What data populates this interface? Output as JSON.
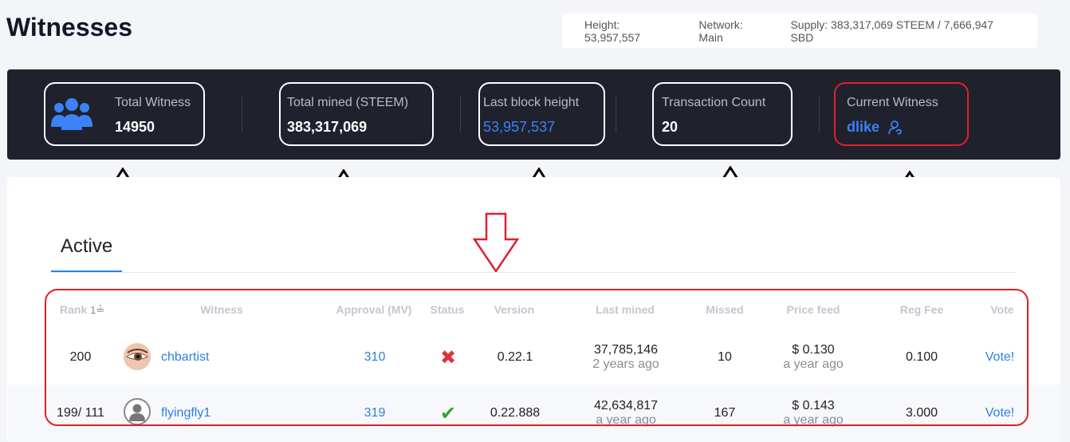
{
  "page": {
    "title": "Witnesses"
  },
  "chain_info": {
    "height": "Height: 53,957,557",
    "network": "Network: Main",
    "supply": "Supply: 383,317,069 STEEM / 7,666,947 SBD"
  },
  "stats": {
    "total_witness": {
      "label": "Total Witness",
      "value": "14950",
      "icon": "users-group-icon"
    },
    "total_mined": {
      "label": "Total mined (STEEM)",
      "value": "383,317,069"
    },
    "last_block": {
      "label": "Last block height",
      "value": "53,957,537"
    },
    "tx_count": {
      "label": "Transaction Count",
      "value": "20"
    },
    "current_witness": {
      "label": "Current Witness",
      "value": "dlike",
      "icon": "user-link-icon"
    }
  },
  "tabs": {
    "active": "Active"
  },
  "table": {
    "headers": {
      "rank": "Rank",
      "rank_sort": "1",
      "witness": "Witness",
      "approval": "Approval (MV)",
      "status": "Status",
      "version": "Version",
      "last_mined": "Last mined",
      "missed": "Missed",
      "price_feed": "Price feed",
      "reg_fee": "Reg Fee",
      "vote": "Vote"
    },
    "rows": [
      {
        "rank": "200",
        "witness": "chbartist",
        "approval": "310",
        "status": "disabled",
        "status_glyph": "✖",
        "version": "0.22.1",
        "last_mined_block": "37,785,146",
        "last_mined_ago": "2 years ago",
        "missed": "10",
        "price": "$ 0.130",
        "price_ago": "a year ago",
        "reg_fee": "0.100",
        "vote": "Vote!"
      },
      {
        "rank": "199/ 111",
        "witness": "flyingfly1",
        "approval": "319",
        "status": "active",
        "status_glyph": "✔",
        "version": "0.22.888",
        "last_mined_block": "42,634,817",
        "last_mined_ago": "a year ago",
        "missed": "167",
        "price": "$ 0.143",
        "price_ago": "a year ago",
        "reg_fee": "3.000",
        "vote": "Vote!"
      }
    ]
  },
  "colors": {
    "accent": "#2f7fe0",
    "annotation_red": "#e0202a",
    "dark_bar": "#1f212c",
    "ok_green": "#3aa13a",
    "error_red": "#e0303a"
  }
}
